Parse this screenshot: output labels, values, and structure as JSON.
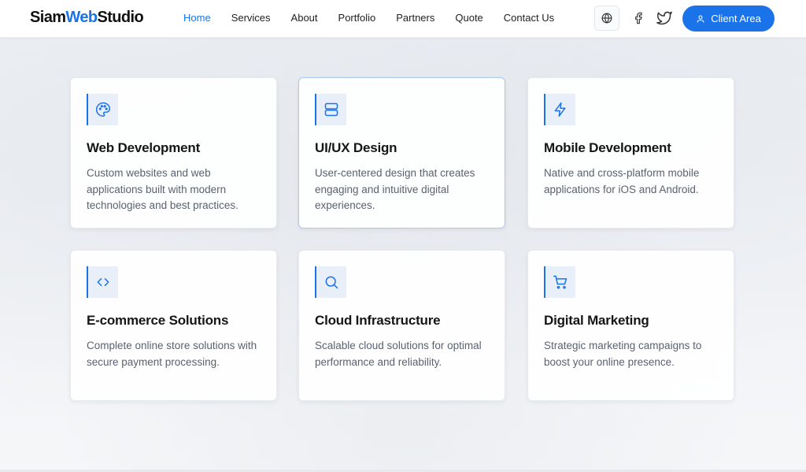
{
  "brand": {
    "part1": "Siam",
    "part2": "Web",
    "part3": "Studio"
  },
  "nav": {
    "items": [
      {
        "label": "Home",
        "active": true
      },
      {
        "label": "Services"
      },
      {
        "label": "About"
      },
      {
        "label": "Portfolio"
      },
      {
        "label": "Partners"
      },
      {
        "label": "Quote"
      },
      {
        "label": "Contact Us"
      }
    ]
  },
  "header_actions": {
    "globe_icon": "globe-icon",
    "facebook_icon": "facebook-icon",
    "twitter_icon": "twitter-icon",
    "client_area_label": "Client Area",
    "client_area_icon": "user-icon"
  },
  "colors": {
    "accent": "#1a73e8",
    "icon_bg": "#e9eff8",
    "title": "#161616",
    "desc": "#5a6270"
  },
  "services": [
    {
      "icon": "palette-icon",
      "title": "Web Development",
      "description": "Custom websites and web applications built with modern technologies and best practices."
    },
    {
      "icon": "server-icon",
      "title": "UI/UX Design",
      "description": "User-centered design that creates engaging and intuitive digital experiences."
    },
    {
      "icon": "lightning-icon",
      "title": "Mobile Development",
      "description": "Native and cross-platform mobile applications for iOS and Android."
    },
    {
      "icon": "code-icon",
      "title": "E-commerce Solutions",
      "description": "Complete online store solutions with secure payment processing."
    },
    {
      "icon": "search-icon",
      "title": "Cloud Infrastructure",
      "description": "Scalable cloud solutions for optimal performance and reliability."
    },
    {
      "icon": "cart-icon",
      "title": "Digital Marketing",
      "description": "Strategic marketing campaigns to boost your online presence."
    }
  ]
}
